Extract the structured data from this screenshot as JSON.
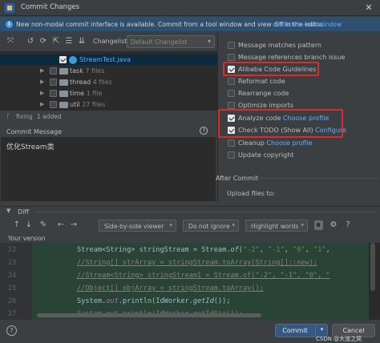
{
  "window": {
    "title": "Commit Changes",
    "close_glyph": "✕"
  },
  "banner": {
    "text": "New non-modal commit interface is available. Commit from a tool window and view diff in the editor.",
    "link": "Switch to tool window"
  },
  "toolbar": {
    "changelist_label": "Changelist:",
    "changelist_value": "Default Changelist"
  },
  "tree": {
    "selected_file": {
      "name": "StreamTest.java",
      "checked": true
    },
    "folders": [
      {
        "name": "task",
        "count": "7 files"
      },
      {
        "name": "thread",
        "count": "4 files"
      },
      {
        "name": "time",
        "count": "1 file"
      },
      {
        "name": "util",
        "count": "27 files"
      }
    ]
  },
  "status": {
    "branch": "fixing",
    "added": "1 added"
  },
  "commit_message": {
    "label": "Commit Message",
    "text": "优化Stream类"
  },
  "options": [
    {
      "label": "Message matches pattern",
      "checked": false
    },
    {
      "label": "Message references branch issue",
      "checked": false
    },
    {
      "label": "Alibaba Code Guidelines",
      "checked": true
    },
    {
      "label": "Reformat code",
      "checked": false
    },
    {
      "label": "Rearrange code",
      "checked": false
    },
    {
      "label": "Optimize imports",
      "checked": false
    },
    {
      "label": "Analyze code",
      "link": "Choose profile",
      "checked": true
    },
    {
      "label": "Check TODO (Show All)",
      "link": "Configure",
      "checked": true
    },
    {
      "label": "Cleanup",
      "link": "Choose profile",
      "checked": false
    },
    {
      "label": "Update copyright",
      "checked": false
    }
  ],
  "after_commit": {
    "label": "After Commit",
    "upload_label": "Upload files to:"
  },
  "diff": {
    "label": "Diff",
    "viewer": "Side-by-side viewer",
    "ignore": "Do not ignore",
    "highlight": "Highlight words",
    "your_version": "Your version",
    "line_numbers": [
      "22",
      "23",
      "24",
      "25",
      "26",
      "27"
    ]
  },
  "footer": {
    "commit": "Commit",
    "cancel": "Cancel",
    "help": "?",
    "watermark": "CSDN @大道之简"
  }
}
